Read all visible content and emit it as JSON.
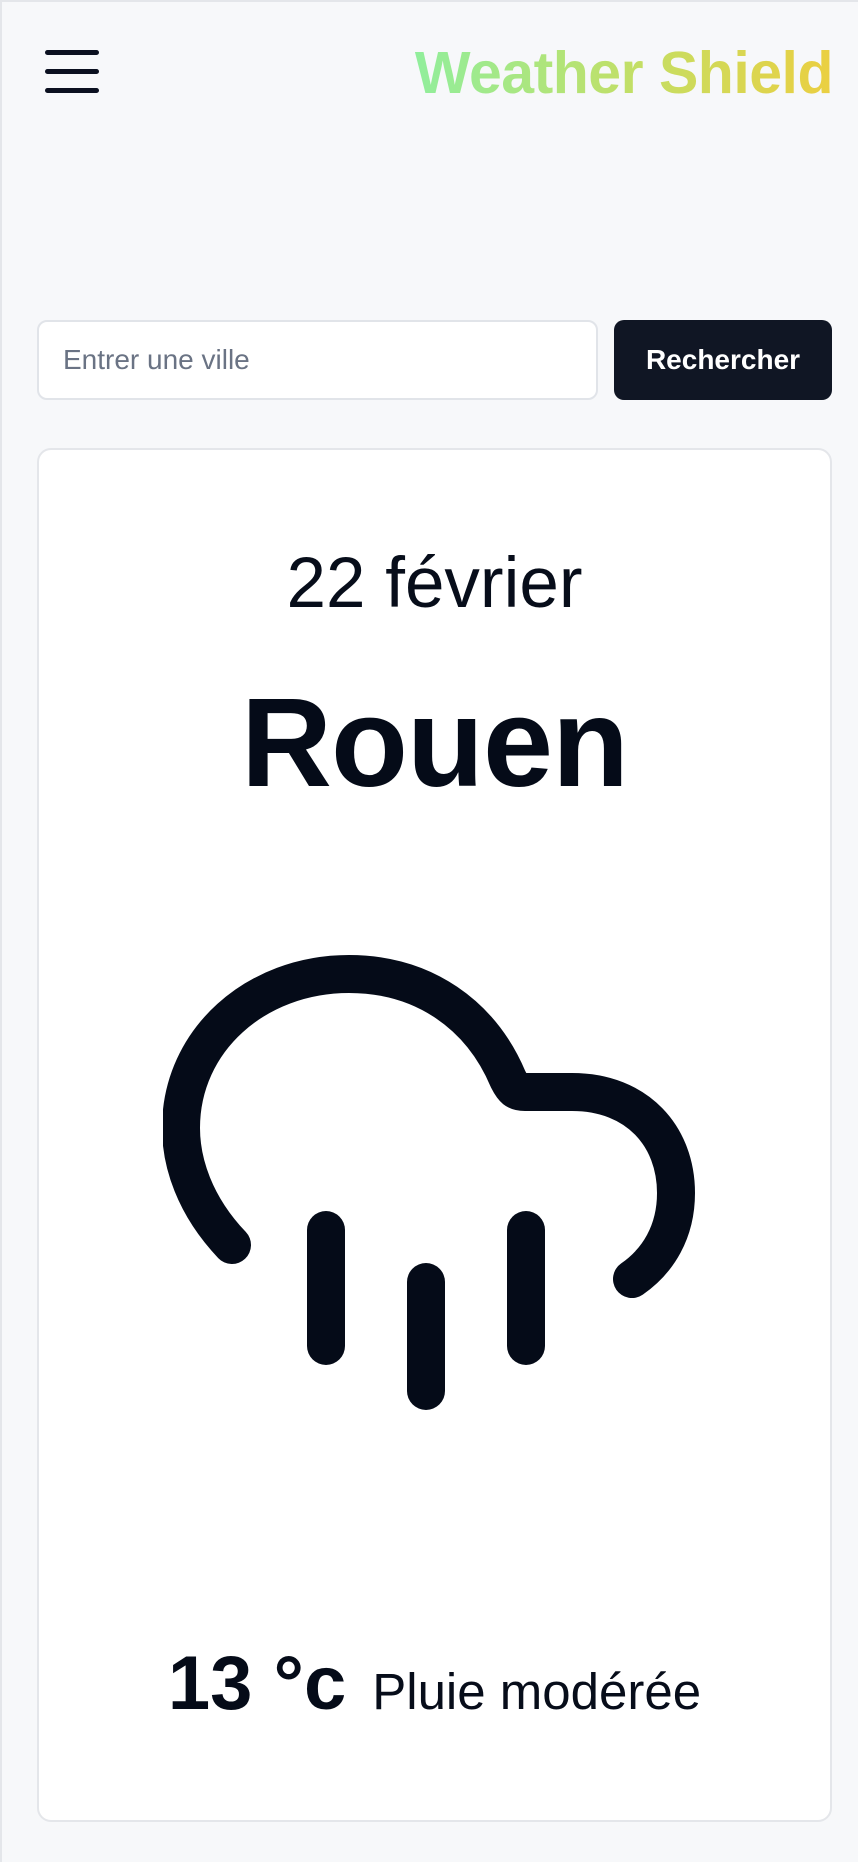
{
  "header": {
    "brand": "Weather Shield",
    "menu_icon": "hamburger-menu-icon"
  },
  "search": {
    "placeholder": "Entrer une ville",
    "value": "",
    "button_label": "Rechercher"
  },
  "weather": {
    "date": "22 février",
    "city": "Rouen",
    "icon": "cloud-rain-icon",
    "temperature": "13 °c",
    "condition": "Pluie modérée"
  },
  "colors": {
    "page_background": "#f7f8fa",
    "card_background": "#ffffff",
    "button_background": "#101624",
    "text_dark": "#050b18",
    "brand_gradient_start": "#91ee9c",
    "brand_gradient_end": "#ebcf41"
  }
}
